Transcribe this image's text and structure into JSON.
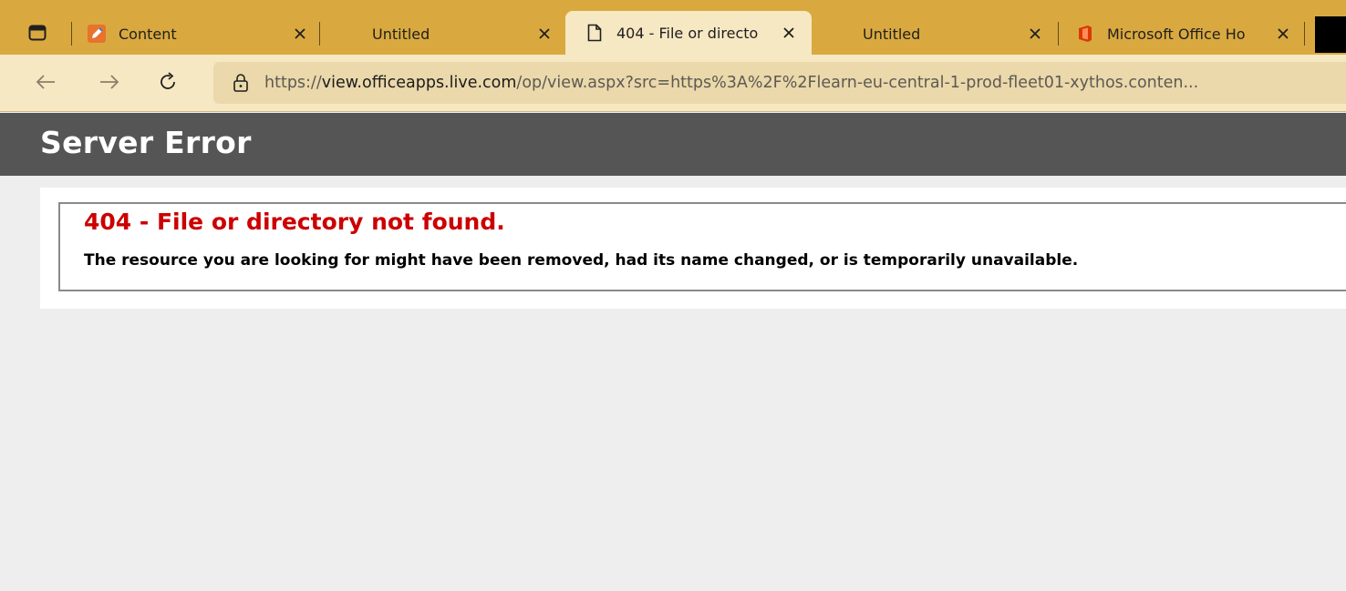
{
  "browser": {
    "tabs": [
      {
        "title": "Content",
        "favicon": "pencil-edit-icon",
        "active": false
      },
      {
        "title": "Untitled",
        "favicon": "",
        "active": false
      },
      {
        "title": "404 - File or directo",
        "favicon": "page-icon",
        "active": true
      },
      {
        "title": "Untitled",
        "favicon": "",
        "active": false
      },
      {
        "title": "Microsoft Office Ho",
        "favicon": "office-logo-icon",
        "active": false
      }
    ],
    "address_bar": {
      "url_prefix": "https://",
      "url_host": "view.officeapps.live.com",
      "url_rest": "/op/view.aspx?src=https%3A%2F%2Flearn-eu-central-1-prod-fleet01-xythos.conten..."
    },
    "colors": {
      "tabstrip": "#d9a93f",
      "toolbar": "#f7e8c4",
      "omnibox": "#ebd8ab"
    }
  },
  "page": {
    "header_title": "Server Error",
    "error_title": "404 - File or directory not found.",
    "error_message": "The resource you are looking for might have been removed, had its name changed, or is temporarily unavailable.",
    "colors": {
      "header_bg": "#555555",
      "error_title": "#cc0000"
    }
  }
}
